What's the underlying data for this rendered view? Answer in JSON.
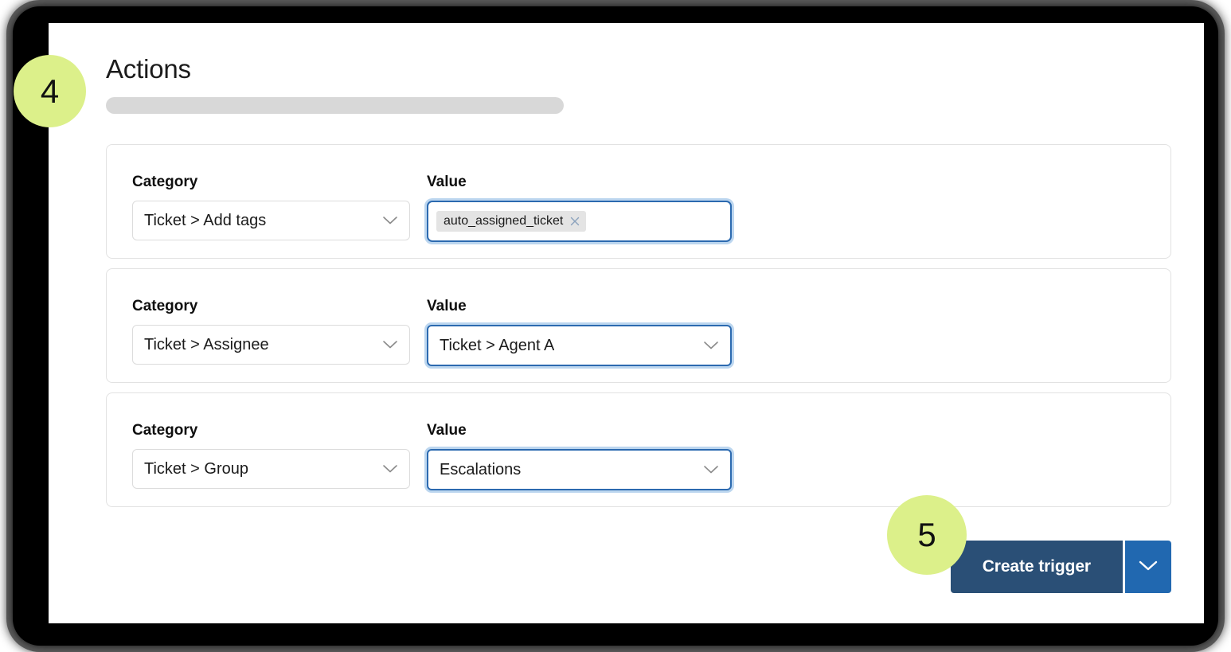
{
  "page": {
    "title": "Actions",
    "placeholder_bar": ""
  },
  "badges": [
    {
      "name": "step-4",
      "label": "4"
    },
    {
      "name": "step-5",
      "label": "5"
    }
  ],
  "labels": {
    "category": "Category",
    "value": "Value"
  },
  "actions": [
    {
      "category_label": "Category",
      "category_value": "Ticket > Add tags",
      "value_label": "Value",
      "value_type": "tags",
      "tags": [
        {
          "text": "auto_assigned_ticket",
          "remove_icon": "close-icon"
        }
      ],
      "focused": true
    },
    {
      "category_label": "Category",
      "category_value": "Ticket > Assignee",
      "value_label": "Value",
      "value_type": "select",
      "value_value": "Ticket > Agent A",
      "focused": true
    },
    {
      "category_label": "Category",
      "category_value": "Ticket > Group",
      "value_label": "Value",
      "value_type": "select",
      "value_value": "Escalations",
      "focused": true
    }
  ],
  "footer": {
    "primary_label": "Create trigger",
    "dropdown_icon": "chevron-down-icon"
  },
  "icons": {
    "chevron_down": "chevron-down-icon"
  },
  "colors": {
    "badge": "#dcf08a",
    "primary_button": "#2a4f76",
    "split_button": "#2168b0",
    "focus_border": "#2c6ab0",
    "focus_ring": "#bcd6ef",
    "skeleton": "#d8d8d8",
    "card_border": "#e2e2e2",
    "chip_bg": "#e4e4e4"
  }
}
